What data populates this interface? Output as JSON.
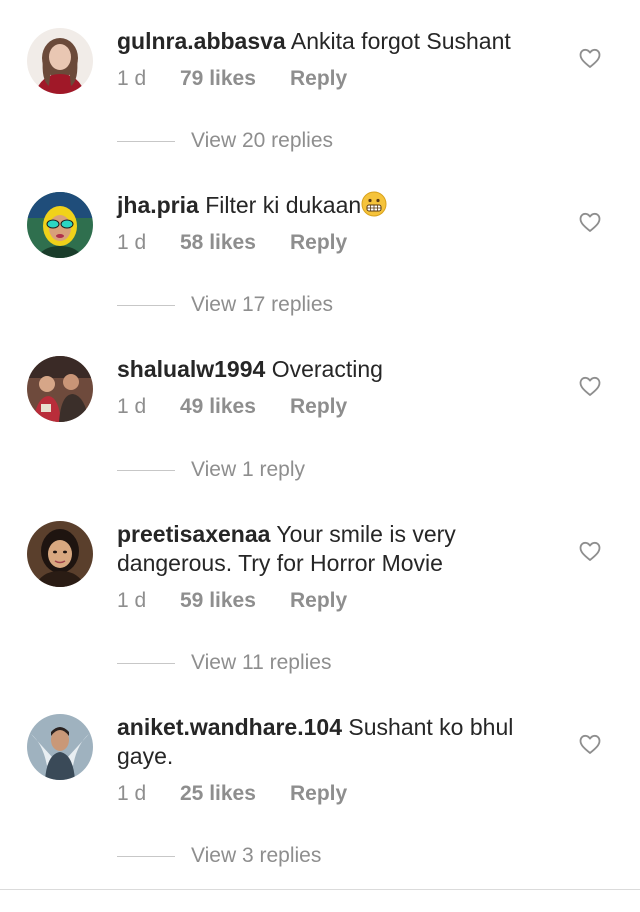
{
  "comments": [
    {
      "username": "gulnra.abbasva",
      "text": "Ankita forgot Sushant",
      "time": "1 d",
      "likes": "79 likes",
      "reply": "Reply",
      "view_replies": "View 20 replies"
    },
    {
      "username": "jha.pria",
      "text": "Filter ki dukaan",
      "emoji": "grimacing-face-emoji",
      "time": "1 d",
      "likes": "58 likes",
      "reply": "Reply",
      "view_replies": "View 17 replies"
    },
    {
      "username": "shalualw1994",
      "text": "Overacting",
      "time": "1 d",
      "likes": "49 likes",
      "reply": "Reply",
      "view_replies": "View 1 reply"
    },
    {
      "username": "preetisaxenaa",
      "text": "Your smile is very dangerous. Try for Horror Movie",
      "time": "1 d",
      "likes": "59 likes",
      "reply": "Reply",
      "view_replies": "View 11 replies"
    },
    {
      "username": "aniket.wandhare.104",
      "text": "Sushant ko bhul gaye.",
      "time": "1 d",
      "likes": "25 likes",
      "reply": "Reply",
      "view_replies": "View 3 replies"
    }
  ],
  "icons": {
    "like": "heart-outline-icon"
  },
  "colors": {
    "text": "#262626",
    "secondary": "#8e8e8e",
    "divider": "#c7c7c7"
  }
}
